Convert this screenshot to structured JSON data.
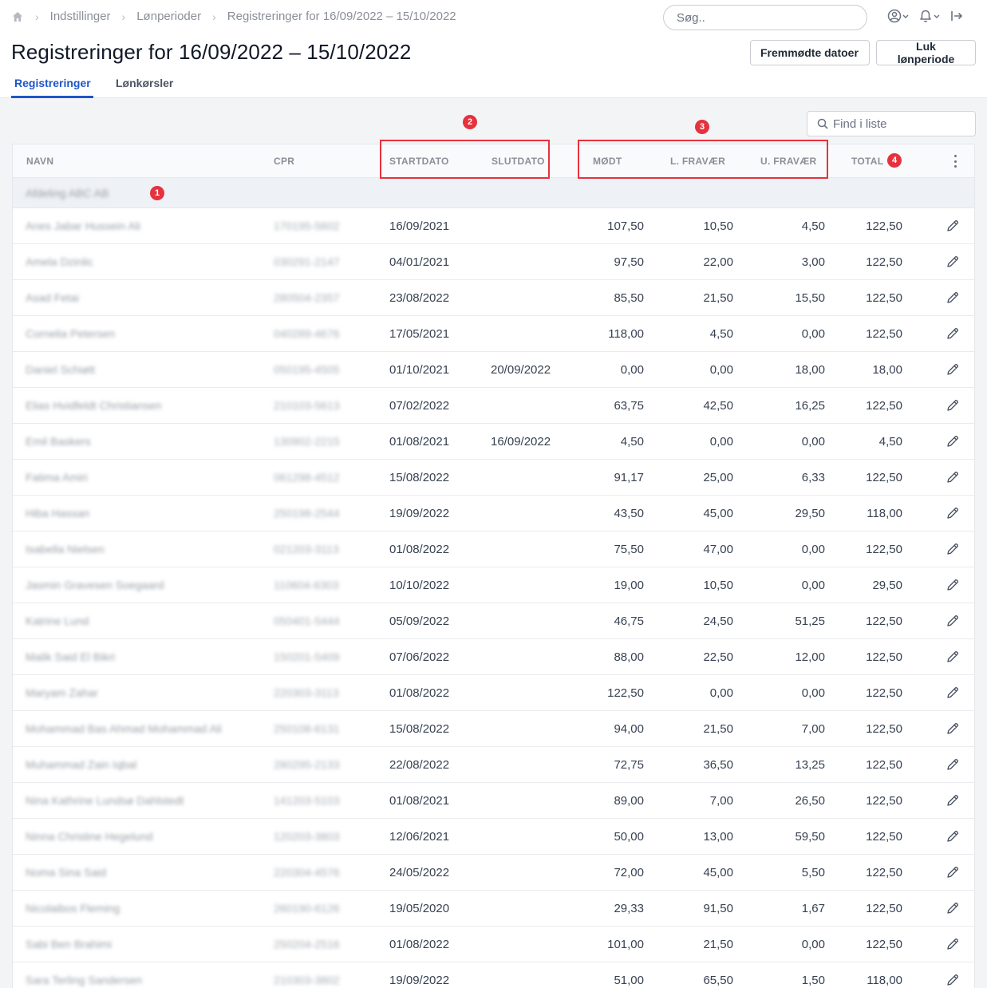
{
  "breadcrumb": {
    "items": [
      "Indstillinger",
      "Lønperioder",
      "Registreringer for 16/09/2022 – 15/10/2022"
    ]
  },
  "search": {
    "placeholder": "Søg.."
  },
  "page": {
    "title": "Registreringer for 16/09/2022 – 15/10/2022"
  },
  "actions": {
    "fremmodte_label": "Fremmødte datoer",
    "luk_label": "Luk lønperiode"
  },
  "tabs": [
    {
      "label": "Registreringer",
      "active": true
    },
    {
      "label": "Lønkørsler",
      "active": false
    }
  ],
  "find": {
    "placeholder": "Find i liste"
  },
  "colors": {
    "accent": "#1e56c8",
    "annotation": "#e6323e"
  },
  "annotations": [
    "1",
    "2",
    "3",
    "4"
  ],
  "table": {
    "columns": {
      "navn": "NAVN",
      "cpr": "CPR",
      "startdato": "STARTDATO",
      "slutdato": "SLUTDATO",
      "modt": "MØDT",
      "lfravaer": "L. FRAVÆR",
      "ufravaer": "U. FRAVÆR",
      "total": "TOTAL"
    },
    "group_label": "Afdeling ABC AB",
    "rows": [
      {
        "name": "Anes Jabar Hussein Ali",
        "cpr": "170195-5602",
        "start": "16/09/2021",
        "end": "",
        "modt": "107,50",
        "lf": "10,50",
        "uf": "4,50",
        "total": "122,50"
      },
      {
        "name": "Amela Dzinlic",
        "cpr": "030291-2147",
        "start": "04/01/2021",
        "end": "",
        "modt": "97,50",
        "lf": "22,00",
        "uf": "3,00",
        "total": "122,50"
      },
      {
        "name": "Asad Fetai",
        "cpr": "280504-2357",
        "start": "23/08/2022",
        "end": "",
        "modt": "85,50",
        "lf": "21,50",
        "uf": "15,50",
        "total": "122,50"
      },
      {
        "name": "Cornelia Petersen",
        "cpr": "040289-4676",
        "start": "17/05/2021",
        "end": "",
        "modt": "118,00",
        "lf": "4,50",
        "uf": "0,00",
        "total": "122,50"
      },
      {
        "name": "Daniel Schiøtt",
        "cpr": "050195-4505",
        "start": "01/10/2021",
        "end": "20/09/2022",
        "modt": "0,00",
        "lf": "0,00",
        "uf": "18,00",
        "total": "18,00"
      },
      {
        "name": "Elias Hvidfeldt Christiansen",
        "cpr": "210103-5613",
        "start": "07/02/2022",
        "end": "",
        "modt": "63,75",
        "lf": "42,50",
        "uf": "16,25",
        "total": "122,50"
      },
      {
        "name": "Emil Baskers",
        "cpr": "130902-2215",
        "start": "01/08/2021",
        "end": "16/09/2022",
        "modt": "4,50",
        "lf": "0,00",
        "uf": "0,00",
        "total": "4,50"
      },
      {
        "name": "Fatima Amiri",
        "cpr": "061298-4512",
        "start": "15/08/2022",
        "end": "",
        "modt": "91,17",
        "lf": "25,00",
        "uf": "6,33",
        "total": "122,50"
      },
      {
        "name": "Hiba Hassan",
        "cpr": "250198-2544",
        "start": "19/09/2022",
        "end": "",
        "modt": "43,50",
        "lf": "45,00",
        "uf": "29,50",
        "total": "118,00"
      },
      {
        "name": "Isabella Nielsen",
        "cpr": "021203-3113",
        "start": "01/08/2022",
        "end": "",
        "modt": "75,50",
        "lf": "47,00",
        "uf": "0,00",
        "total": "122,50"
      },
      {
        "name": "Jasmin Gravesen Soegaard",
        "cpr": "110604-6303",
        "start": "10/10/2022",
        "end": "",
        "modt": "19,00",
        "lf": "10,50",
        "uf": "0,00",
        "total": "29,50"
      },
      {
        "name": "Katrine Lund",
        "cpr": "050401-5444",
        "start": "05/09/2022",
        "end": "",
        "modt": "46,75",
        "lf": "24,50",
        "uf": "51,25",
        "total": "122,50"
      },
      {
        "name": "Malik Said El Bikri",
        "cpr": "150201-5409",
        "start": "07/06/2022",
        "end": "",
        "modt": "88,00",
        "lf": "22,50",
        "uf": "12,00",
        "total": "122,50"
      },
      {
        "name": "Maryam Zahar",
        "cpr": "220303-3113",
        "start": "01/08/2022",
        "end": "",
        "modt": "122,50",
        "lf": "0,00",
        "uf": "0,00",
        "total": "122,50"
      },
      {
        "name": "Mohammad Bas Ahmad Mohammad Ali",
        "cpr": "250108-6131",
        "start": "15/08/2022",
        "end": "",
        "modt": "94,00",
        "lf": "21,50",
        "uf": "7,00",
        "total": "122,50"
      },
      {
        "name": "Muhammad Zain Iqbal",
        "cpr": "280295-2133",
        "start": "22/08/2022",
        "end": "",
        "modt": "72,75",
        "lf": "36,50",
        "uf": "13,25",
        "total": "122,50"
      },
      {
        "name": "Nina Kathrine Lundsø Dahlstedt",
        "cpr": "141203-5103",
        "start": "01/08/2021",
        "end": "",
        "modt": "89,00",
        "lf": "7,00",
        "uf": "26,50",
        "total": "122,50"
      },
      {
        "name": "Ninna Christine Hegelund",
        "cpr": "120203-3803",
        "start": "12/06/2021",
        "end": "",
        "modt": "50,00",
        "lf": "13,00",
        "uf": "59,50",
        "total": "122,50"
      },
      {
        "name": "Noma Sina Said",
        "cpr": "220304-4576",
        "start": "24/05/2022",
        "end": "",
        "modt": "72,00",
        "lf": "45,00",
        "uf": "5,50",
        "total": "122,50"
      },
      {
        "name": "Nicolaibos Fleming",
        "cpr": "260190-6126",
        "start": "19/05/2020",
        "end": "",
        "modt": "29,33",
        "lf": "91,50",
        "uf": "1,67",
        "total": "122,50"
      },
      {
        "name": "Sabi Ben Brahimi",
        "cpr": "250204-2516",
        "start": "01/08/2022",
        "end": "",
        "modt": "101,00",
        "lf": "21,50",
        "uf": "0,00",
        "total": "122,50"
      },
      {
        "name": "Sara Terling Sandersen",
        "cpr": "210303-3802",
        "start": "19/09/2022",
        "end": "",
        "modt": "51,00",
        "lf": "65,50",
        "uf": "1,50",
        "total": "118,00"
      }
    ]
  }
}
